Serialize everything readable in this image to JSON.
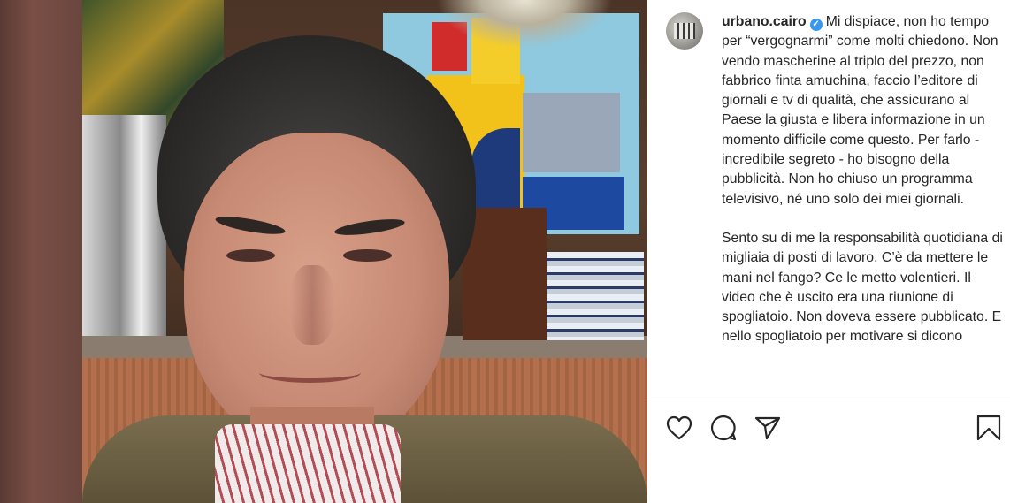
{
  "post": {
    "username": "urbano.cairo",
    "verified_icon": "verified-badge-icon",
    "caption_paragraphs": [
      "Mi dispiace, non ho tempo per “vergognarmi” come molti chiedono. Non vendo mascherine al triplo del prezzo, non fabbrico finta amuchina, faccio l’editore di giornali e tv di qualità, che assicurano al Paese la giusta e libera informazione in un momento difficile come questo. Per farlo - incredibile segreto - ho bisogno della pubblicità. Non ho chiuso un programma televisivo, né uno solo dei miei giornali.",
      "Sento su di me la responsabilità quotidiana di migliaia di posti di lavoro. C’è da mettere le mani nel fango? Ce le metto volentieri. Il video che è uscito era una riunione di spogliatoio. Non doveva essere pubblicato. E nello spogliatoio per motivare si dicono"
    ]
  },
  "actions": {
    "like_icon": "heart-icon",
    "comment_icon": "comment-icon",
    "share_icon": "paper-plane-icon",
    "save_icon": "bookmark-icon"
  },
  "colors": {
    "text": "#262626",
    "verified": "#3897f0",
    "divider": "#efefef"
  }
}
